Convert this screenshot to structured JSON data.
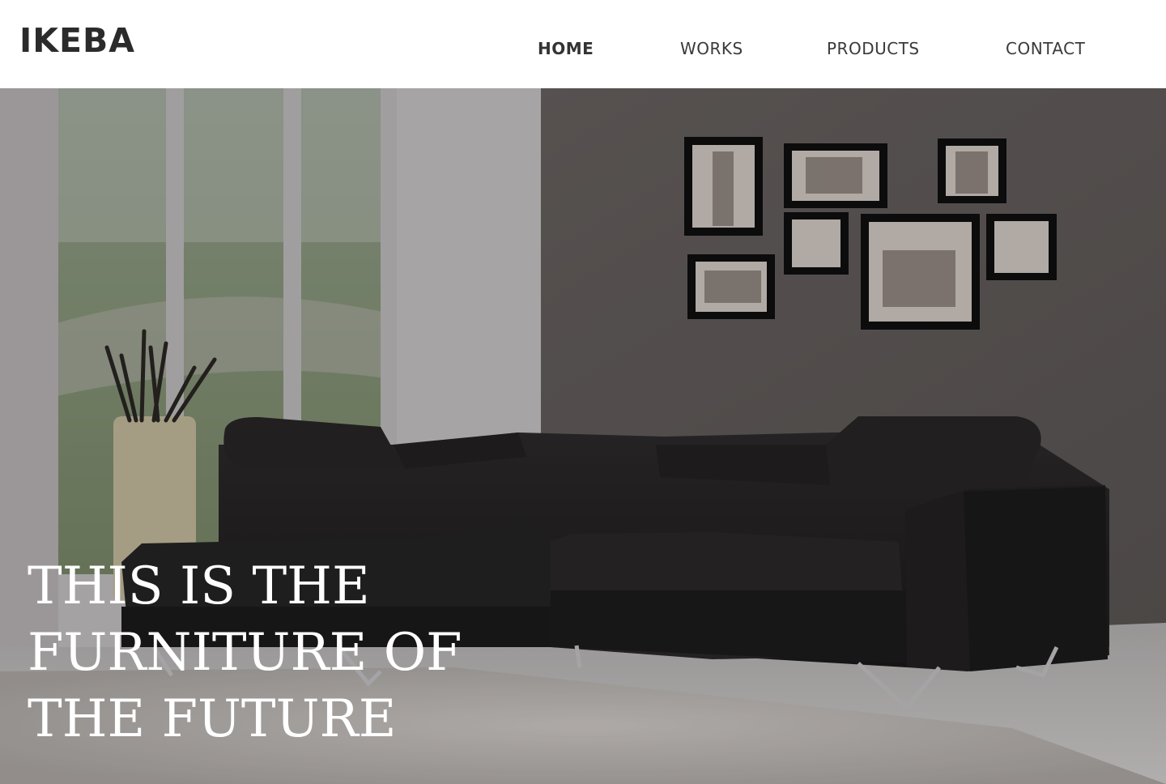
{
  "brand": {
    "logo_text": "IKEBA"
  },
  "nav": {
    "items": [
      {
        "label": "HOME",
        "active": true
      },
      {
        "label": "WORKS",
        "active": false
      },
      {
        "label": "PRODUCTS",
        "active": false
      },
      {
        "label": "CONTACT",
        "active": false
      }
    ]
  },
  "hero": {
    "title_lines": [
      "THIS IS THE",
      "FURNITURE OF",
      "THE FUTURE"
    ],
    "image_subject": "living-room-sofa-photo"
  },
  "colors": {
    "header_bg": "#ffffff",
    "text_dark": "#2b2b2b",
    "hero_text": "#ffffff"
  }
}
